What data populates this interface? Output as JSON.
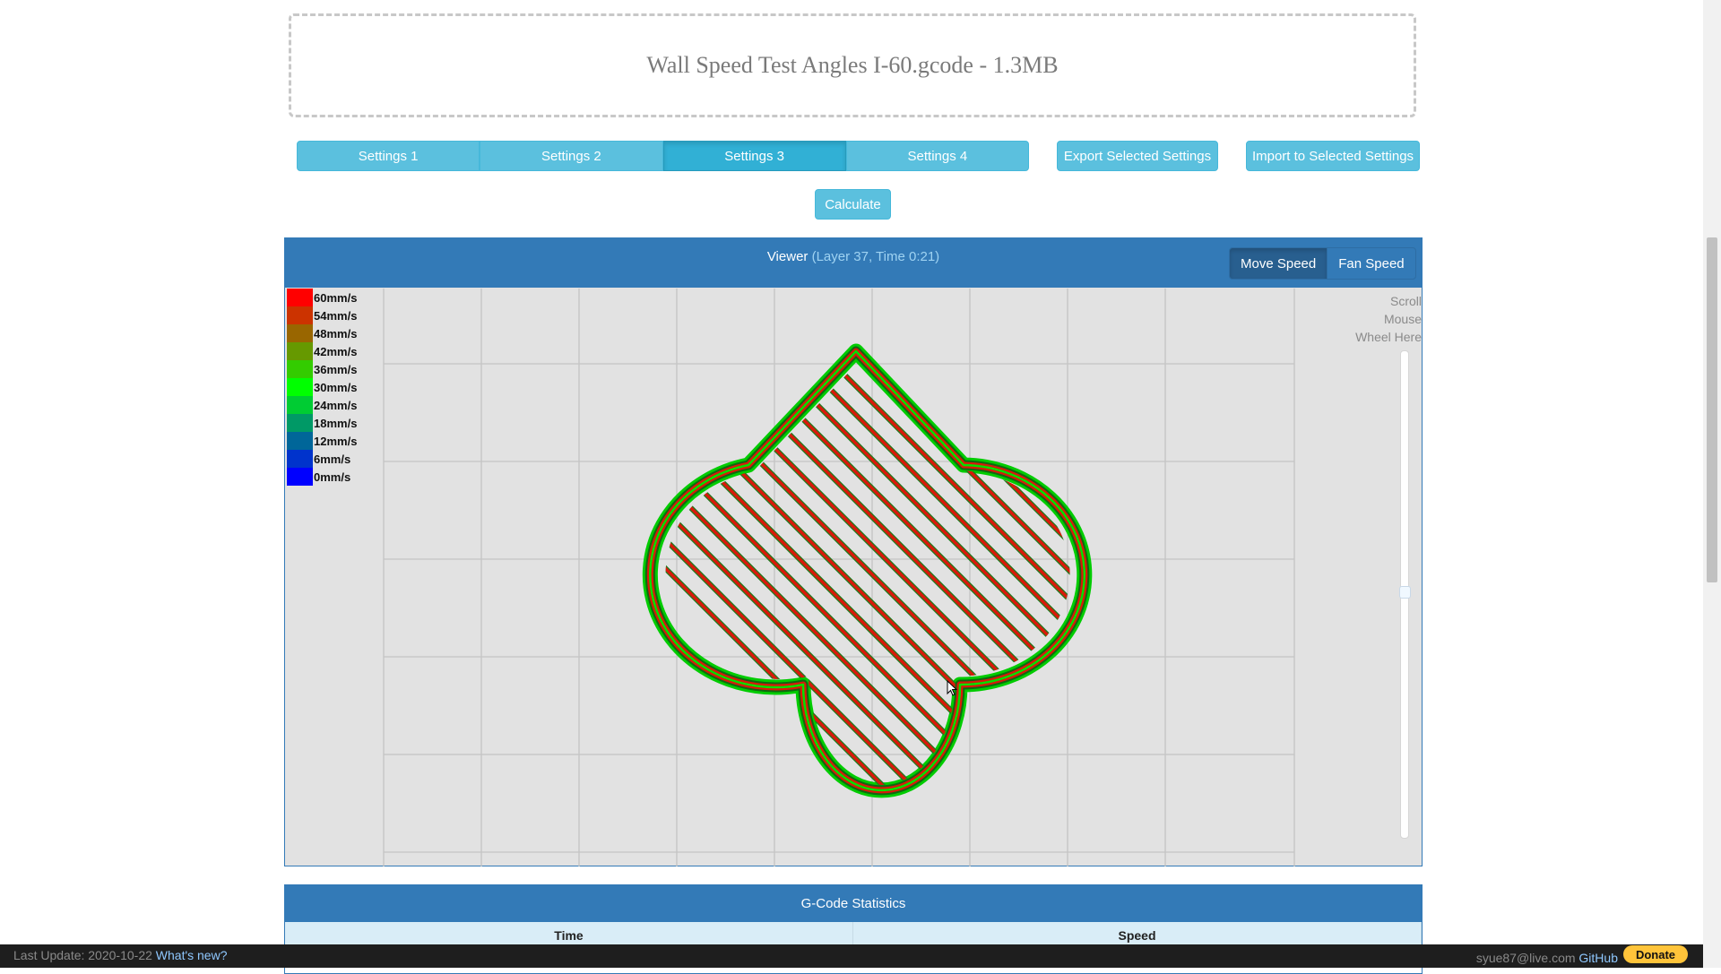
{
  "dropzone": {
    "file_label": "Wall Speed Test Angles I-60.gcode - 1.3MB"
  },
  "settings_tabs": [
    {
      "label": "Settings 1",
      "active": false
    },
    {
      "label": "Settings 2",
      "active": false
    },
    {
      "label": "Settings 3",
      "active": true
    },
    {
      "label": "Settings 4",
      "active": false
    }
  ],
  "buttons": {
    "export": "Export Selected Settings",
    "import": "Import to Selected Settings",
    "calculate": "Calculate"
  },
  "viewer": {
    "title": "Viewer",
    "subtitle": "(Layer 37, Time 0:21)",
    "toggle": {
      "move_speed": "Move Speed",
      "fan_speed": "Fan Speed",
      "selected": "Move Speed"
    },
    "scroll_hint": [
      "Scroll",
      "Mouse",
      "Wheel Here"
    ],
    "legend": [
      {
        "label": "60mm/s",
        "color": "#ff0000"
      },
      {
        "label": "54mm/s",
        "color": "#cc3300"
      },
      {
        "label": "48mm/s",
        "color": "#996600"
      },
      {
        "label": "42mm/s",
        "color": "#669900"
      },
      {
        "label": "36mm/s",
        "color": "#33cc00"
      },
      {
        "label": "30mm/s",
        "color": "#00ff00"
      },
      {
        "label": "24mm/s",
        "color": "#00cc33"
      },
      {
        "label": "18mm/s",
        "color": "#009966"
      },
      {
        "label": "12mm/s",
        "color": "#006699"
      },
      {
        "label": "6mm/s",
        "color": "#0033cc"
      },
      {
        "label": "0mm/s",
        "color": "#0000ff"
      }
    ],
    "layer_slider_position": 0.5
  },
  "stats": {
    "title": "G-Code Statistics",
    "columns": [
      "Time",
      "Speed"
    ]
  },
  "footer": {
    "last_update": "Last Update: 2020-10-22",
    "whats_new": "What's new?",
    "email": "syue87@live.com",
    "github": "GitHub",
    "donate": "Donate"
  }
}
